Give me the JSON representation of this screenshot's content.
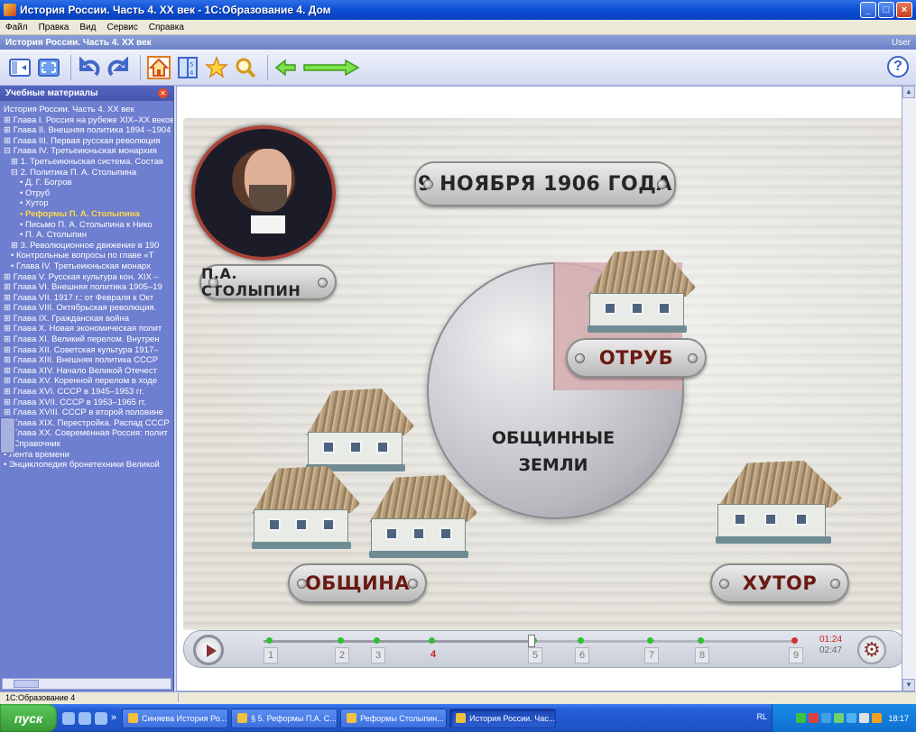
{
  "window": {
    "title": "История России. Часть 4. XX век - 1С:Образование 4. Дом",
    "buttons": {
      "minimize": "_",
      "maximize": "□",
      "close": "×"
    }
  },
  "menu": [
    "Файл",
    "Правка",
    "Вид",
    "Сервис",
    "Справка"
  ],
  "doc_header": {
    "title": "История России. Часть 4. XX век",
    "user": "User"
  },
  "toolbar": {
    "items": [
      "panel-toggle-icon",
      "fullscreen-icon",
      "undo-icon",
      "redo-icon",
      "home-icon",
      "book-icon",
      "star-icon",
      "search-icon",
      "back-arrow-icon",
      "forward-arrow-icon"
    ],
    "help": "?"
  },
  "sidebar": {
    "title": "Учебные материалы",
    "items": [
      {
        "text": "История России. Часть 4. XX век",
        "level": 0
      },
      {
        "text": "⊞ Глава I. Россия на рубеже XIX–XX веков",
        "level": 0
      },
      {
        "text": "⊞ Глава II. Внешняя политика 1894 –1904",
        "level": 0
      },
      {
        "text": "⊞ Глава III. Первая русская революция",
        "level": 0
      },
      {
        "text": "⊟ Глава IV. Третьеиюньская монархия",
        "level": 0
      },
      {
        "text": "⊞ 1. Третьеиюньская система. Состав",
        "level": 1
      },
      {
        "text": "⊟ 2. Политика П. А. Столыпина",
        "level": 1
      },
      {
        "text": "• Д. Г. Богров",
        "level": 2
      },
      {
        "text": "• Отруб",
        "level": 2
      },
      {
        "text": "• Хутор",
        "level": 2
      },
      {
        "text": "• Реформы П. А. Столыпина",
        "level": 2,
        "active": true
      },
      {
        "text": "• Письмо П. А. Столыпина к Нико",
        "level": 2
      },
      {
        "text": "• П. А. Столыпин",
        "level": 2
      },
      {
        "text": "⊞ 3. Революционное движение в 190",
        "level": 1
      },
      {
        "text": "• Контрольные вопросы по главе «Т",
        "level": 1
      },
      {
        "text": "• Глава IV. Третьеиюньская монарх",
        "level": 1
      },
      {
        "text": "⊞ Глава V. Русская культура кон. XIX –",
        "level": 0
      },
      {
        "text": "⊞ Глава VI. Внешняя политика 1905–19",
        "level": 0
      },
      {
        "text": "⊞ Глава VII. 1917 г.: от Февраля к Окт",
        "level": 0
      },
      {
        "text": "⊞ Глава VIII. Октябрьская революция.",
        "level": 0
      },
      {
        "text": "⊞ Глава IX. Гражданская война",
        "level": 0
      },
      {
        "text": "⊞ Глава X. Новая экономическая полит",
        "level": 0
      },
      {
        "text": "⊞ Глава XI. Великий перелом. Внутрен",
        "level": 0
      },
      {
        "text": "⊞ Глава XII. Советская культура 1917–",
        "level": 0
      },
      {
        "text": "⊞ Глава XIII. Внешняя политика СССР",
        "level": 0
      },
      {
        "text": "⊞ Глава XIV. Начало Великой Отечест",
        "level": 0
      },
      {
        "text": "⊞ Глава XV. Коренной перелом в ходе",
        "level": 0
      },
      {
        "text": "⊞ Глава XVI. СССР в 1945–1953 гг.",
        "level": 0
      },
      {
        "text": "⊞ Глава XVII. СССР в 1953–1965 гг.",
        "level": 0
      },
      {
        "text": "⊞ Глава XVIII. СССР в второй половине",
        "level": 0
      },
      {
        "text": "⊞ Глава XIX. Перестройка. Распад СССР",
        "level": 0
      },
      {
        "text": "⊞ Глава XX. Современная Россия: полит",
        "level": 0
      },
      {
        "text": "⊞ Справочник",
        "level": 0
      },
      {
        "text": "• Лента времени",
        "level": 0
      },
      {
        "text": "• Энциклопедия бронетехники Великой",
        "level": 0
      }
    ]
  },
  "slide": {
    "date_label": "9 НОЯБРЯ 1906 ГОДА",
    "portrait_label": "П.А. СТОЛЫПИН",
    "circle_line1": "ОБЩИННЫЕ",
    "circle_line2": "ЗЕМЛИ",
    "otrub_label": "ОТРУБ",
    "obshchina_label": "ОБЩИНА",
    "khutor_label": "ХУТОР"
  },
  "timeline": {
    "steps": [
      "1",
      "2",
      "3",
      "4",
      "5",
      "6",
      "7",
      "8",
      "9"
    ],
    "current_step": "4",
    "elapsed": "01:24",
    "total": "02:47"
  },
  "statusbar": {
    "text": "1С:Образование 4"
  },
  "taskbar": {
    "start": "пуск",
    "tasks": [
      {
        "label": "Синяева История Ро...",
        "active": false
      },
      {
        "label": "§ 5. Реформы П.А. С...",
        "active": false
      },
      {
        "label": "Реформы Столыпин...",
        "active": false
      },
      {
        "label": "История России. Час...",
        "active": true
      }
    ],
    "lang": "RL",
    "clock": "18:17",
    "colors": {
      "taskbar": "#245ed8",
      "start": "#379a36",
      "tray": "#0e6fd0"
    }
  }
}
